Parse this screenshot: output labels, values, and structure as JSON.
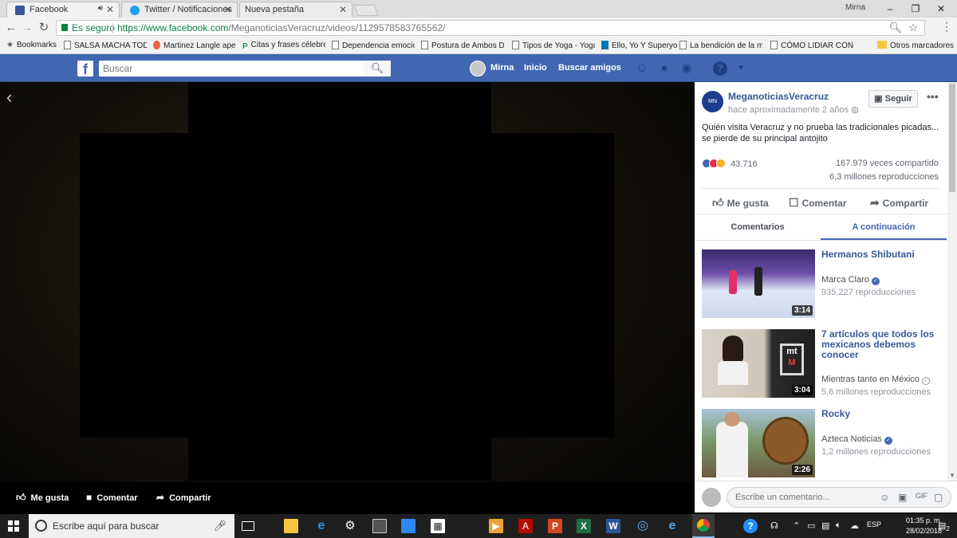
{
  "browser": {
    "tabs": [
      {
        "title": "Facebook",
        "icon_color": "#3b5998",
        "active": true
      },
      {
        "title": "Twitter / Notificaciones",
        "icon_color": "#1da1f2",
        "active": false
      },
      {
        "title": "Nueva pestaña",
        "icon_color": "",
        "active": false
      }
    ],
    "profile_name": "Mirna",
    "secure_label": "Es seguro",
    "url_host": "https://www.facebook.com",
    "url_path": "/MeganoticiasVeracruz/videos/1129578583765562/",
    "bookmarks_label": "Bookmarks",
    "bookmarks": [
      "SALSA MACHA TODA",
      "Martinez Langle apel",
      "Citas y frases célebre",
      "Dependencia emocio",
      "Postura de Ambos D",
      "Tipos de Yoga - Yoga",
      "Ello, Yo Y Superyo",
      "La bendición de la m",
      "CÓMO LIDIAR CON S"
    ],
    "other_bookmarks": "Otros marcadores"
  },
  "fb_header": {
    "search_placeholder": "Buscar",
    "user_name": "Mirna",
    "home_label": "Inicio",
    "find_friends_label": "Buscar amigos",
    "brand_color": "#4267b2"
  },
  "video_bar": {
    "like": "Me gusta",
    "comment": "Comentar",
    "share": "Compartir"
  },
  "post": {
    "page_name": "MeganoticiasVeracruz",
    "time": "hace aproximadamente 2 años",
    "follow_label": "Seguir",
    "text": "Quién visita Veracruz y no prueba las tradicionales picadas... se pierde de su principal antojito",
    "reaction_count": "43.716",
    "shares": "167.979 veces compartido",
    "views": "6,3 millones reproducciones",
    "like": "Me gusta",
    "comment": "Comentar",
    "share": "Compartir",
    "tab_comments": "Comentarios",
    "tab_next": "A continuación",
    "comment_placeholder": "Escribe un comentario..."
  },
  "up_next": [
    {
      "title": "Hermanos Shibutani",
      "channel": "Marca Claro",
      "verified": "blue",
      "views": "935.227 reproducciones",
      "duration": "3:14"
    },
    {
      "title": "7 artículos que todos los mexicanos debemos conocer",
      "channel": "Mientras tanto en México",
      "verified": "grey",
      "views": "5,6 millones reproducciones",
      "duration": "3:04"
    },
    {
      "title": "Rocky",
      "channel": "Azteca Noticias",
      "verified": "blue",
      "views": "1,2 millones reproducciones",
      "duration": "2:26"
    }
  ],
  "taskbar": {
    "search_placeholder": "Escribe aquí para buscar",
    "lang": "ESP",
    "time": "01:35 p. m.",
    "date": "28/02/2018",
    "notifications": "2"
  }
}
